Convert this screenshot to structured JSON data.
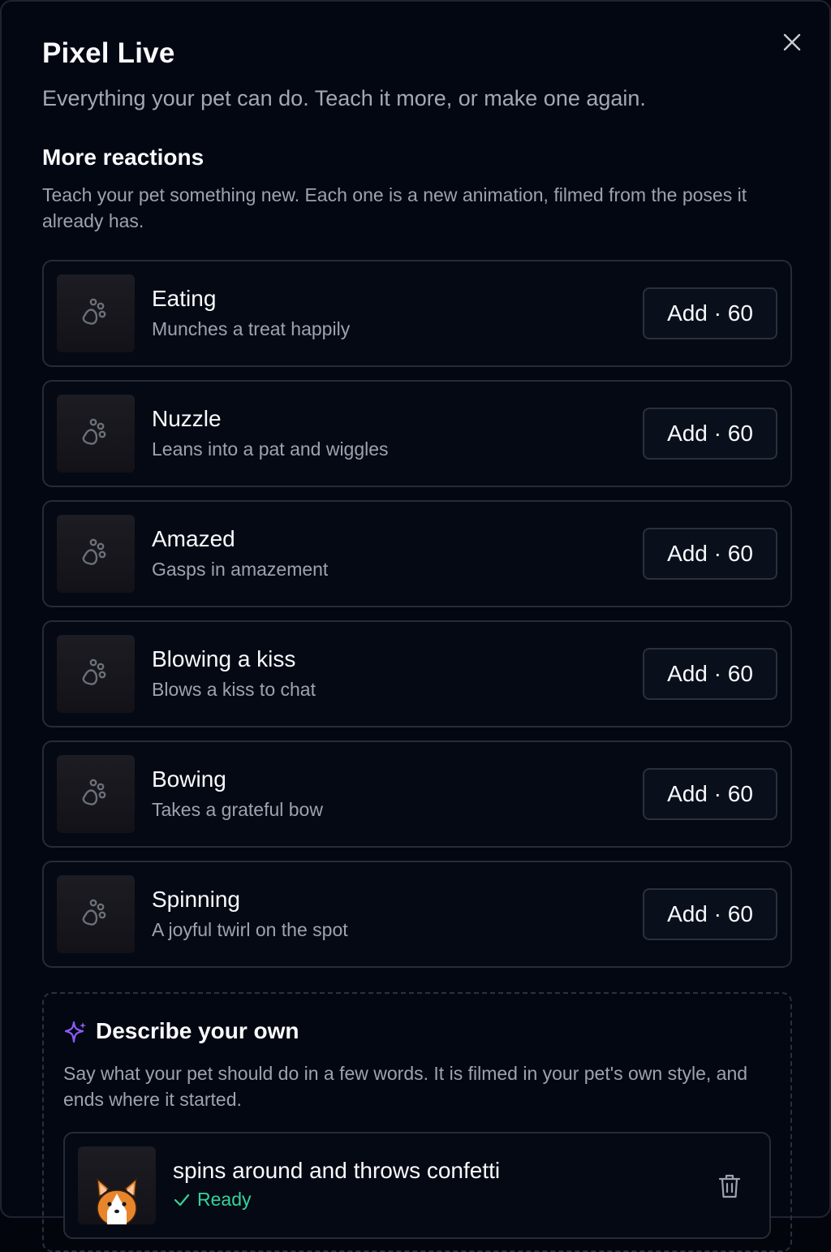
{
  "header": {
    "title": "Pixel Live",
    "subtitle": "Everything your pet can do. Teach it more, or make one again."
  },
  "reactions_section": {
    "title": "More reactions",
    "description": "Teach your pet something new. Each one is a new animation, filmed from the poses it already has.",
    "items": [
      {
        "name": "Eating",
        "description": "Munches a treat happily",
        "button": "Add · 60",
        "icon": "paw-icon"
      },
      {
        "name": "Nuzzle",
        "description": "Leans into a pat and wiggles",
        "button": "Add · 60",
        "icon": "paw-icon"
      },
      {
        "name": "Amazed",
        "description": "Gasps in amazement",
        "button": "Add · 60",
        "icon": "paw-icon"
      },
      {
        "name": "Blowing a kiss",
        "description": "Blows a kiss to chat",
        "button": "Add · 60",
        "icon": "paw-icon"
      },
      {
        "name": "Bowing",
        "description": "Takes a grateful bow",
        "button": "Add · 60",
        "icon": "paw-icon"
      },
      {
        "name": "Spinning",
        "description": "A joyful twirl on the spot",
        "button": "Add · 60",
        "icon": "paw-icon"
      }
    ]
  },
  "custom_section": {
    "title": "Describe your own",
    "description": "Say what your pet should do in a few words. It is filmed in your pet's own style, and ends where it started.",
    "items": [
      {
        "text": "spins around and throws confetti",
        "status": "Ready",
        "status_icon": "check-icon",
        "delete_icon": "trash-icon"
      }
    ]
  },
  "colors": {
    "background": "#030712",
    "accent_sparkle": "#8b5cf6",
    "status_ready": "#34d399"
  }
}
